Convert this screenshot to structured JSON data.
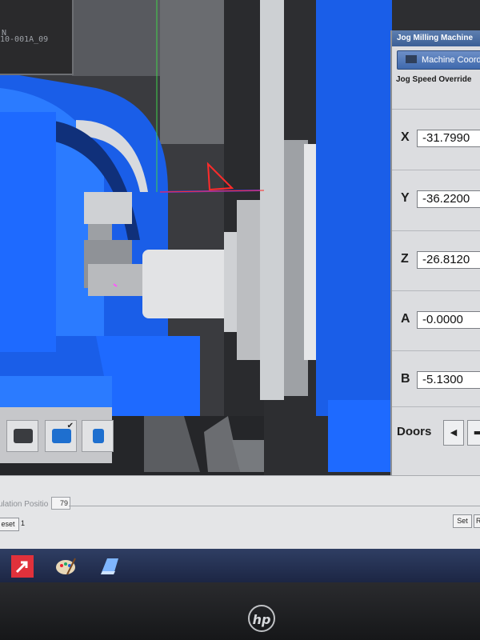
{
  "info_window": {
    "line1": "N",
    "line2": "10-001A_09"
  },
  "panel": {
    "title": "Jog Milling Machine",
    "coord_tab": "Machine Coord",
    "jog_speed_override": "Jog Speed Override",
    "axes": [
      {
        "label": "X",
        "value": "-31.7990"
      },
      {
        "label": "Y",
        "value": "-36.2200"
      },
      {
        "label": "Z",
        "value": "-26.8120"
      },
      {
        "label": "A",
        "value": "-0.0000"
      },
      {
        "label": "B",
        "value": "-5.1300"
      }
    ],
    "doors_label": "Doors",
    "doors_left": "◀",
    "doors_right": "▬"
  },
  "bottom": {
    "sim_position_label": "ulation Positio",
    "sim_position_value": "79",
    "reset_label": "eset",
    "reset_count": "1",
    "set_label": "Set",
    "edge_label": "R"
  },
  "colors": {
    "machine_blue": "#1a5ee8",
    "panel_gray": "#dcdde0",
    "taskbar": "#1c2644"
  },
  "icons": [
    "tool-change-icon",
    "fixture-icon",
    "spindle-icon",
    "paint-icon",
    "app-icon",
    "shortcut-icon"
  ]
}
